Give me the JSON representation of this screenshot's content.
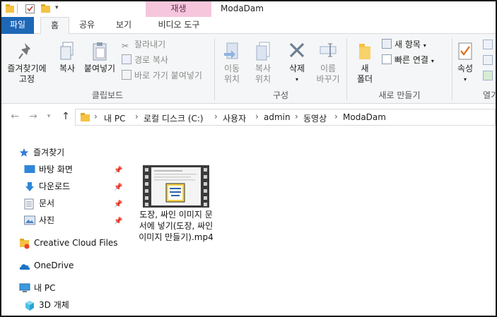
{
  "titlebar": {
    "context_tab": "재생",
    "window_title": "ModaDam"
  },
  "tabs": [
    {
      "label": "파일",
      "active": false,
      "file": true
    },
    {
      "label": "홈",
      "active": true
    },
    {
      "label": "공유",
      "active": false
    },
    {
      "label": "보기",
      "active": false
    },
    {
      "label": "비디오 도구",
      "active": false
    }
  ],
  "ribbon": {
    "clipboard": {
      "pin_quick": "즐겨찾기에\n고정",
      "copy": "복사",
      "paste": "붙여넣기",
      "cut": "잘라내기",
      "copy_path": "경로 복사",
      "paste_shortcut": "바로 가기 붙여넣기",
      "label": "클립보드"
    },
    "organize": {
      "move_to": "이동\n위치",
      "copy_to": "복사\n위치",
      "delete": "삭제",
      "rename": "이름\n바꾸기",
      "label": "구성"
    },
    "new": {
      "new_folder": "새\n폴더",
      "new_item": "새 항목",
      "easy_access": "빠른 연결",
      "label": "새로 만들기"
    },
    "open": {
      "properties": "속성",
      "label": "열기"
    }
  },
  "address": {
    "crumbs": [
      "내 PC",
      "로컬 디스크 (C:)",
      "사용자",
      "admin",
      "동영상",
      "ModaDam"
    ]
  },
  "navpane": {
    "quick_access": "즐겨찾기",
    "items": [
      {
        "label": "바탕 화면",
        "icon": "desktop-icon",
        "pinned": true
      },
      {
        "label": "다운로드",
        "icon": "download-icon",
        "pinned": true
      },
      {
        "label": "문서",
        "icon": "documents-icon",
        "pinned": true
      },
      {
        "label": "사진",
        "icon": "pictures-icon",
        "pinned": true
      }
    ],
    "creative_cloud": "Creative Cloud Files",
    "onedrive": "OneDrive",
    "this_pc": "내 PC",
    "objects_3d": "3D 개체"
  },
  "files": [
    {
      "name": "도장, 싸인 이미지 문서에 넣기(도장, 싸인 이미지 만들기).mp4",
      "icon": "video-file-icon"
    }
  ],
  "colors": {
    "file_tab": "#1e67b6",
    "context_tab": "#f6c6dd",
    "folder": "#f5c242",
    "star": "#3a7bd5"
  }
}
